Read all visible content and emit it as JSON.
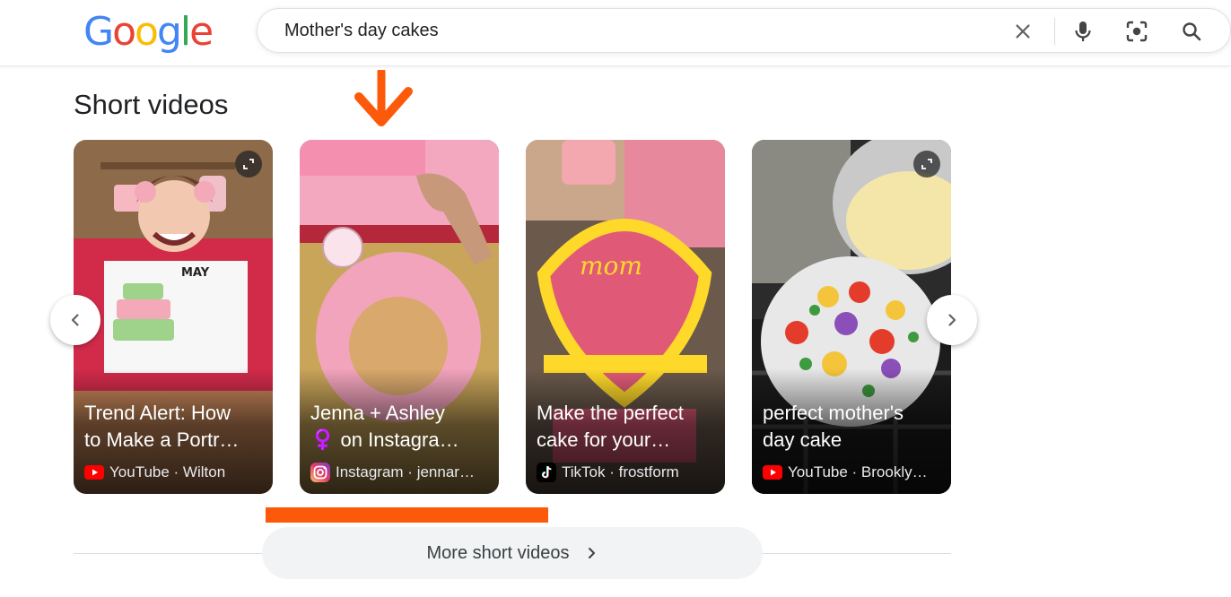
{
  "search": {
    "query": "Mother's day cakes"
  },
  "logo": {
    "letters": [
      "G",
      "o",
      "o",
      "g",
      "l",
      "e"
    ],
    "colors": [
      "#4285F4",
      "#EA4335",
      "#FBBC05",
      "#4285F4",
      "#34A853",
      "#EA4335"
    ]
  },
  "section": {
    "title": "Short videos"
  },
  "cards": [
    {
      "title_line1": "Trend Alert: How",
      "title_line2": "to Make a Portr…",
      "source": "YouTube · Wilton",
      "platform_icon": "youtube-icon"
    },
    {
      "title_line1": "Jenna + Ashley",
      "title_line2": "♀️ on Instagra…",
      "source": "Instagram · jennar…",
      "platform_icon": "instagram-icon"
    },
    {
      "title_line1": "Make the perfect",
      "title_line2": "cake for your…",
      "source": "TikTok · frostform",
      "platform_icon": "tiktok-icon"
    },
    {
      "title_line1": "perfect mother's",
      "title_line2": "day cake",
      "source": "YouTube · Brookly…",
      "platform_icon": "youtube-icon"
    }
  ],
  "more": {
    "label": "More short videos"
  },
  "colors": {
    "annotation_orange": "#fc5a0a",
    "youtube_red": "#ff0000"
  }
}
